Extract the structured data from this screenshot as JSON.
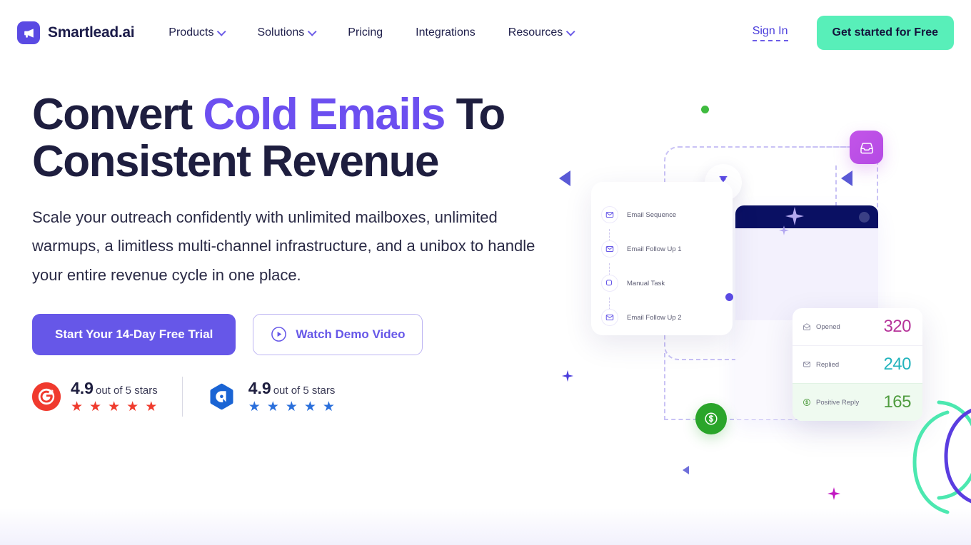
{
  "brand": {
    "name": "Smartlead.ai",
    "logo_icon": "megaphone-icon",
    "logo_bg": "#5a4ae3"
  },
  "nav": {
    "links": [
      {
        "label": "Products",
        "has_dropdown": true
      },
      {
        "label": "Solutions",
        "has_dropdown": true
      },
      {
        "label": "Pricing",
        "has_dropdown": false
      },
      {
        "label": "Integrations",
        "has_dropdown": false
      },
      {
        "label": "Resources",
        "has_dropdown": true
      }
    ],
    "sign_in": "Sign In",
    "cta": "Get started for Free",
    "cta_color": "#58efb9"
  },
  "hero": {
    "headline_part1": "Convert ",
    "headline_accent": "Cold Emails",
    "headline_part2": " To Consistent Revenue",
    "accent_color": "#6c4ff0",
    "subhead": "Scale your outreach confidently with unlimited mailboxes, unlimited warmups, a limitless multi-channel infrastructure, and a unibox to handle your entire revenue cycle in one place.",
    "primary_cta": "Start Your 14-Day Free Trial",
    "secondary_cta": "Watch Demo Video",
    "primary_cta_color": "#6657e8"
  },
  "ratings": [
    {
      "source": "g2",
      "score": "4.9",
      "suffix": "out of 5 stars",
      "stars": 5,
      "star_color": "#ef3b2d",
      "badge_color": "#f03a2e"
    },
    {
      "source": "capterra",
      "score": "4.9",
      "suffix": "out of 5 stars",
      "stars": 5,
      "star_color": "#2a6fdb",
      "badge_color": "#1a64d4"
    }
  ],
  "illustration": {
    "sequence_card": {
      "steps": [
        {
          "label": "Email Sequence",
          "icon": "envelope-icon"
        },
        {
          "label": "Email Follow Up 1",
          "icon": "envelope-icon"
        },
        {
          "label": "Manual Task",
          "icon": "manual-task-icon"
        },
        {
          "label": "Email Follow Up 2",
          "icon": "envelope-icon"
        }
      ]
    },
    "stats_card": {
      "rows": [
        {
          "label": "Opened",
          "value": "320",
          "color": "#b6349a",
          "icon": "mail-open-icon"
        },
        {
          "label": "Replied",
          "value": "240",
          "color": "#23b4bd",
          "icon": "mail-reply-icon"
        },
        {
          "label": "Positive Reply",
          "value": "165",
          "color": "#4f9c3f",
          "icon": "dollar-circle-icon"
        }
      ]
    },
    "inbox_tile_icon": "inbox-tray-icon",
    "hourglass_icon": "hourglass-icon",
    "money_icon": "dollar-icon"
  }
}
